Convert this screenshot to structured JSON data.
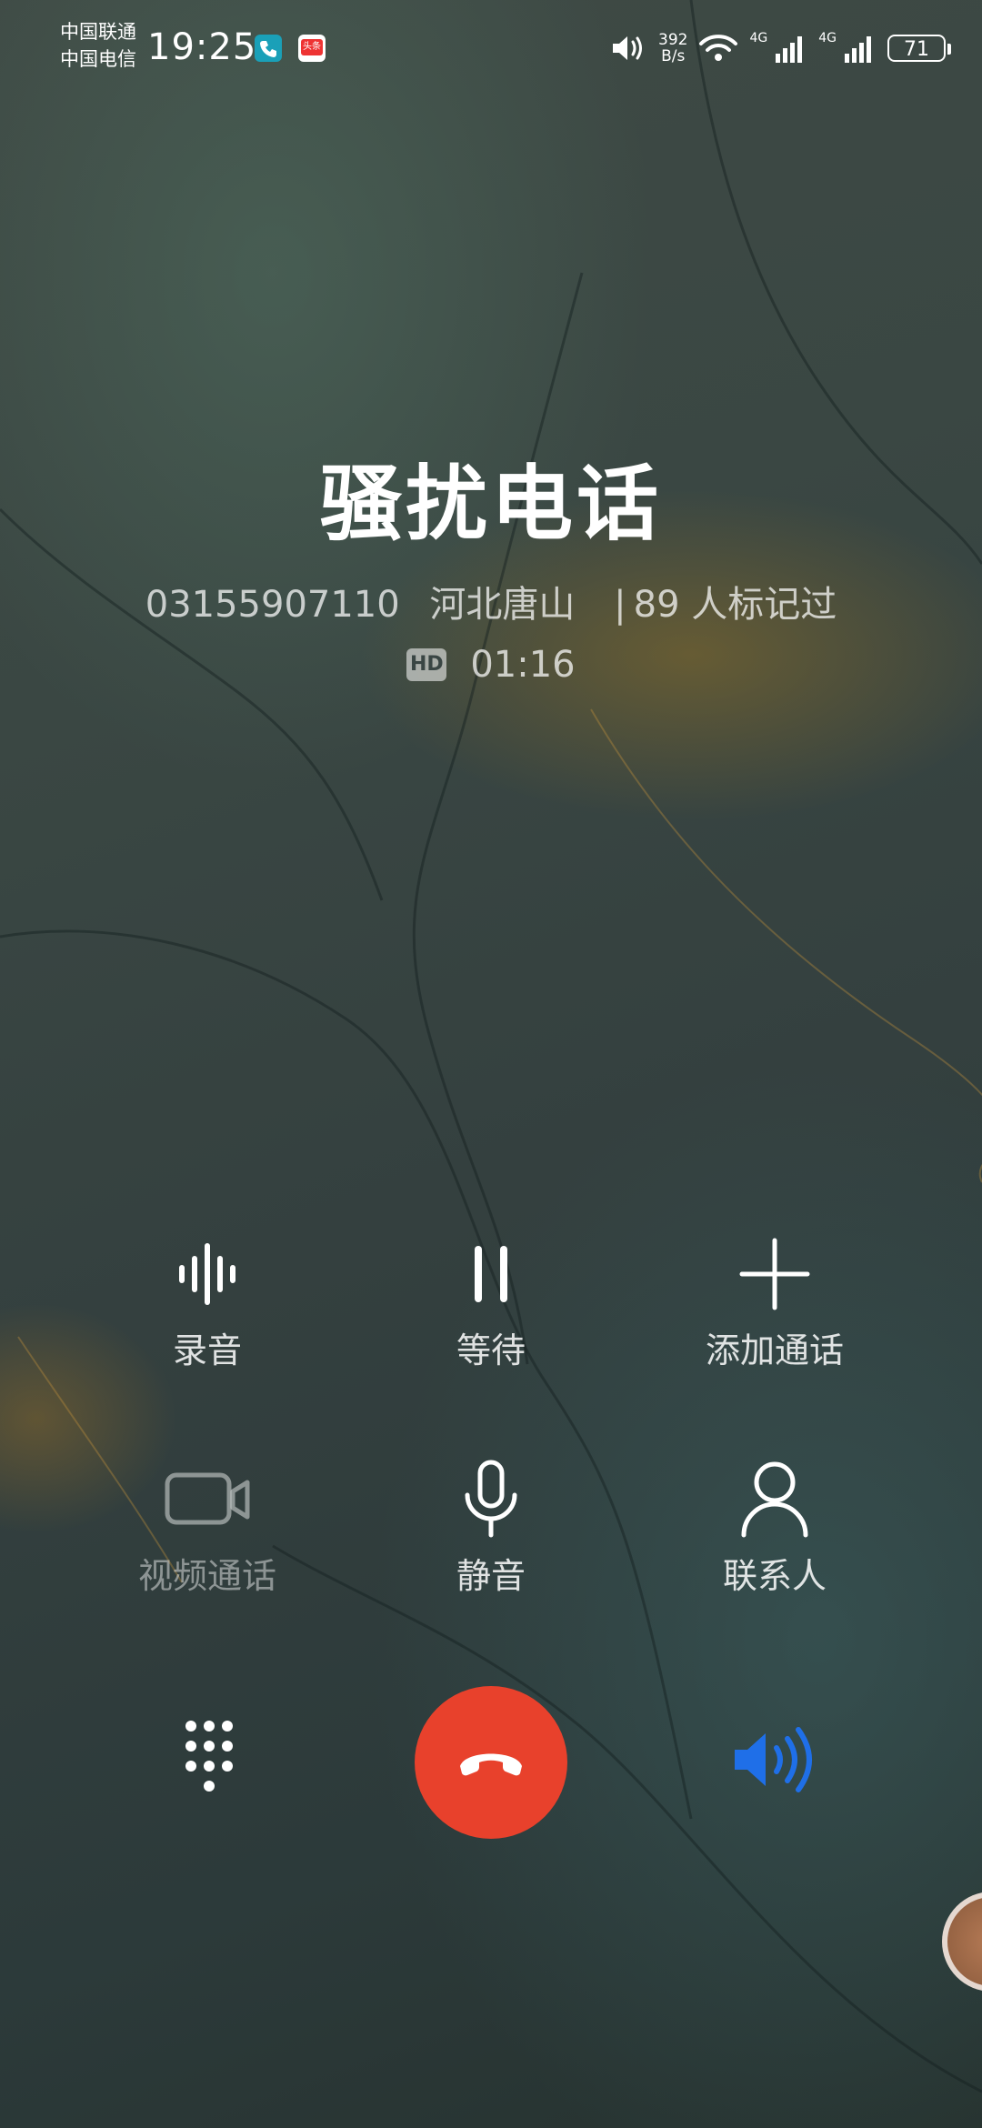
{
  "status_bar": {
    "carrier_1": "中国联通",
    "carrier_2": "中国电信",
    "time": "19:25",
    "news_app_label": "头条",
    "net_speed_value": "392",
    "net_speed_unit": "B/s",
    "signal_1_label": "4G",
    "signal_2_label": "4G",
    "battery": "71"
  },
  "caller": {
    "name": "骚扰电话",
    "number": "03155907110",
    "location": "河北唐山",
    "separator": "|",
    "tag_count": "89 人标记过",
    "hd_label": "HD",
    "duration": "01:16"
  },
  "actions": {
    "record": "录音",
    "hold": "等待",
    "add_call": "添加通话",
    "video_call": "视频通话",
    "mute": "静音",
    "contacts": "联系人"
  },
  "icons": {
    "record": "waveform-icon",
    "hold": "pause-icon",
    "add_call": "plus-icon",
    "video_call": "video-camera-icon",
    "mute": "microphone-icon",
    "contacts": "person-icon",
    "dialpad": "dialpad-icon",
    "hangup": "hang-up-icon",
    "speaker": "speaker-icon"
  },
  "colors": {
    "hangup": "#e8412c",
    "speaker_active": "#1f6fe8"
  }
}
